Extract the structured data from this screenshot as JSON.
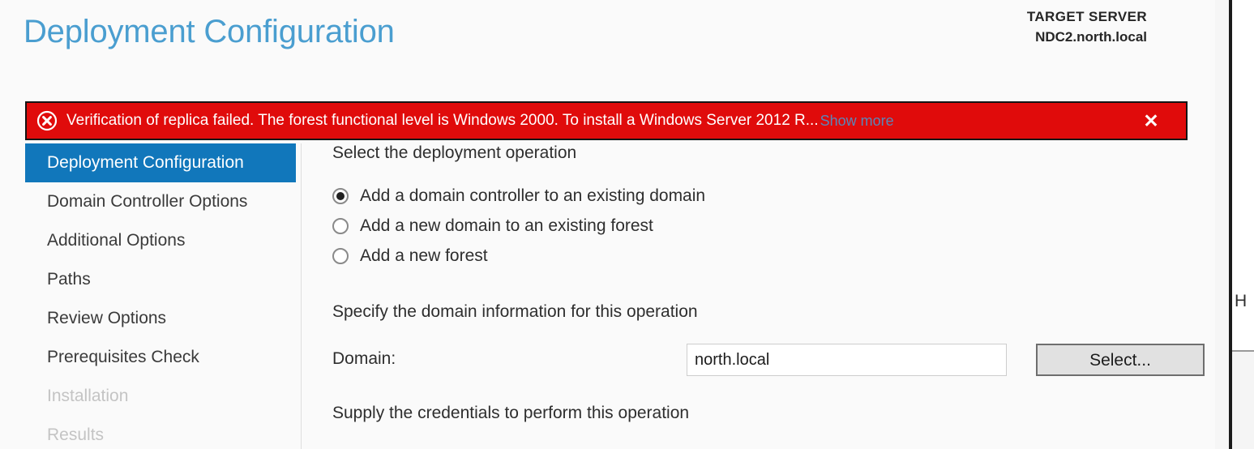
{
  "header": {
    "title": "Deployment Configuration",
    "target_server_label": "TARGET SERVER",
    "target_server_name": "NDC2.north.local"
  },
  "notification": {
    "icon": "error-circle-x-icon",
    "message": "Verification of replica failed. The forest functional level is Windows 2000. To install a Windows Server 2012 R...",
    "show_more_label": "Show more",
    "close_label": "✕",
    "background_color": "#e00b0b",
    "text_color": "#ffffff",
    "link_color": "#5a86b8"
  },
  "sidebar": {
    "accent_color": "#1177bb",
    "items": [
      {
        "label": "Deployment Configuration",
        "state": "selected"
      },
      {
        "label": "Domain Controller Options",
        "state": "enabled"
      },
      {
        "label": "Additional Options",
        "state": "enabled"
      },
      {
        "label": "Paths",
        "state": "enabled"
      },
      {
        "label": "Review Options",
        "state": "enabled"
      },
      {
        "label": "Prerequisites Check",
        "state": "enabled"
      },
      {
        "label": "Installation",
        "state": "disabled"
      },
      {
        "label": "Results",
        "state": "disabled"
      }
    ]
  },
  "content": {
    "operation_section_label": "Select the deployment operation",
    "operations": [
      {
        "label": "Add a domain controller to an existing domain",
        "checked": true
      },
      {
        "label": "Add a new domain to an existing forest",
        "checked": false
      },
      {
        "label": "Add a new forest",
        "checked": false
      }
    ],
    "domain_section_label": "Specify the domain information for this operation",
    "domain_field_label": "Domain:",
    "domain_value": "north.local",
    "domain_placeholder": "",
    "select_button_label": "Select...",
    "credentials_section_label": "Supply the credentials to perform this operation"
  },
  "background_window": {
    "clipped_text": "H"
  },
  "scrollbar": {
    "thumb_color": "#62c4e8"
  }
}
